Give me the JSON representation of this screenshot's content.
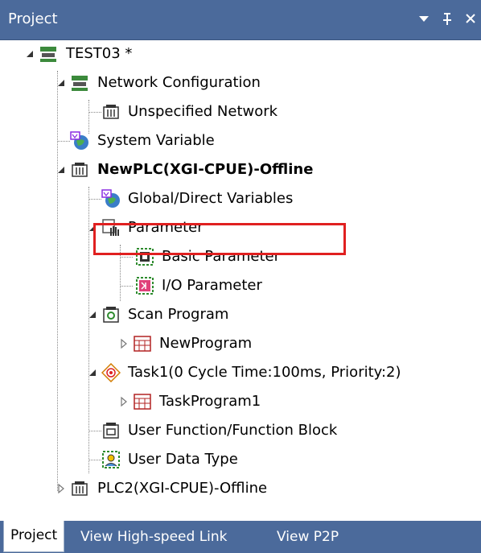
{
  "panel": {
    "title": "Project",
    "dropdown_glyph": "▾",
    "pin_glyph": "ᵖ",
    "close_glyph": "×"
  },
  "tree": {
    "project": "TEST03 *",
    "network_configuration": "Network Configuration",
    "unspecified_network": "Unspecified Network",
    "system_variable": "System Variable",
    "plc1": "NewPLC(XGI-CPUE)-Offline",
    "global_direct_variables": "Global/Direct Variables",
    "parameter": "Parameter",
    "basic_parameter": "Basic Parameter",
    "io_parameter": "I/O Parameter",
    "scan_program": "Scan Program",
    "new_program": "NewProgram",
    "task1": "Task1(0 Cycle Time:100ms, Priority:2)",
    "task_program1": "TaskProgram1",
    "user_function_block": "User Function/Function Block",
    "user_data_type": "User Data Type",
    "plc2": "PLC2(XGI-CPUE)-Offline"
  },
  "tabs": [
    "Project",
    "View High-speed Link",
    "View P2P"
  ],
  "colors": {
    "title_bar": "#4b6a9b",
    "highlight_border": "#e02020"
  }
}
